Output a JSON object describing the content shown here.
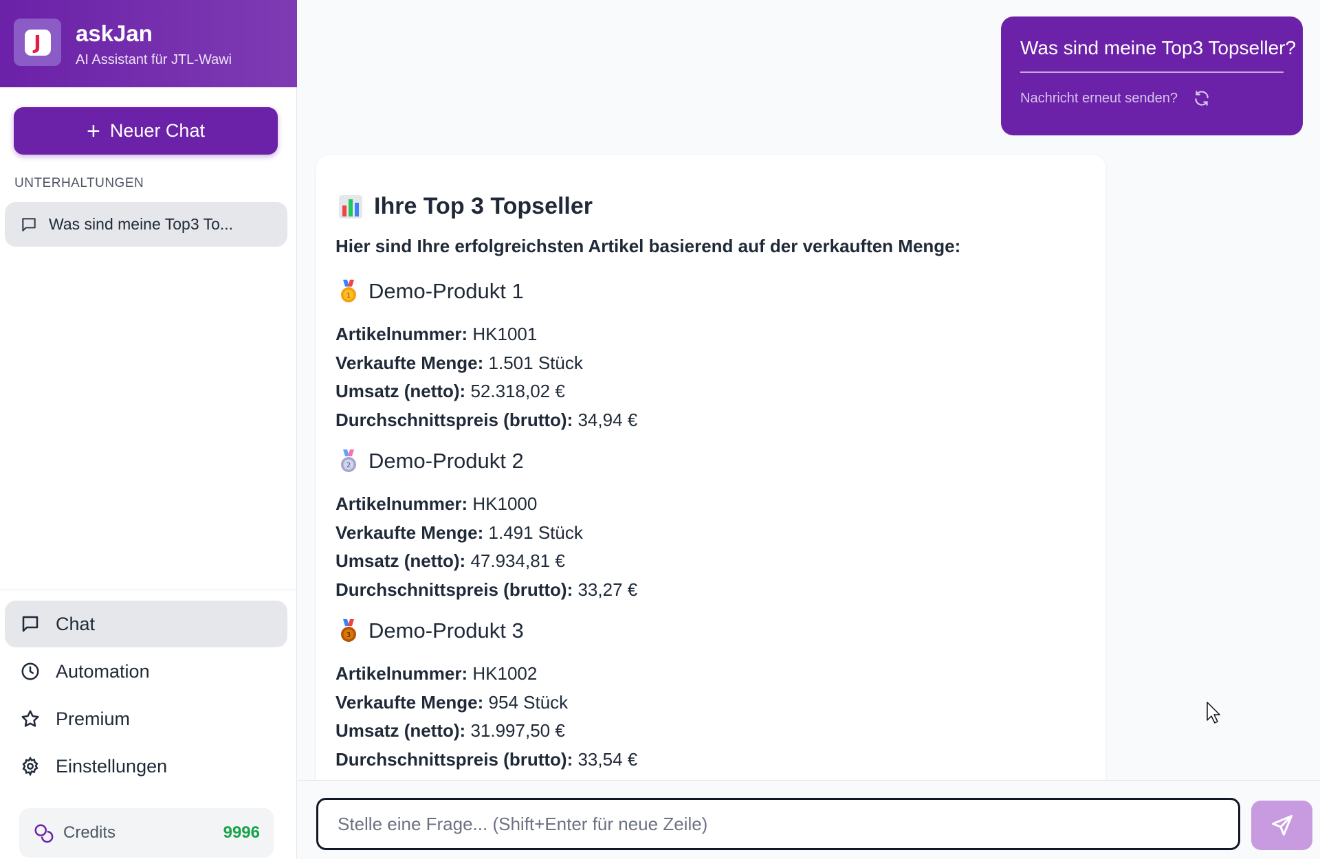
{
  "brand": {
    "title": "askJan",
    "subtitle": "AI Assistant für JTL-Wawi",
    "logo_letter": "J"
  },
  "sidebar": {
    "new_chat_label": "Neuer Chat",
    "conversations_heading": "UNTERHALTUNGEN",
    "conversations": [
      {
        "title": "Was sind meine Top3 To..."
      }
    ],
    "nav": [
      {
        "label": "Chat",
        "icon": "chat-icon",
        "active": true
      },
      {
        "label": "Automation",
        "icon": "clock-icon",
        "active": false
      },
      {
        "label": "Premium",
        "icon": "star-icon",
        "active": false
      },
      {
        "label": "Einstellungen",
        "icon": "gear-icon",
        "active": false
      }
    ],
    "credits": {
      "label": "Credits",
      "value": "9996"
    }
  },
  "user_message": {
    "text": "Was sind meine Top3 Topseller?",
    "resend_label": "Nachricht erneut senden?"
  },
  "answer": {
    "title": "Ihre Top 3 Topseller",
    "intro": "Hier sind Ihre erfolgreichsten Artikel basierend auf der verkauften Menge:",
    "products": [
      {
        "name": "Demo-Produkt 1",
        "medal": "gold",
        "rows": [
          {
            "key": "Artikelnummer:",
            "value": "HK1001"
          },
          {
            "key": "Verkaufte Menge:",
            "value": "1.501 Stück"
          },
          {
            "key": "Umsatz (netto):",
            "value": "52.318,02 €"
          },
          {
            "key": "Durchschnittspreis (brutto):",
            "value": "34,94 €"
          }
        ]
      },
      {
        "name": "Demo-Produkt 2",
        "medal": "silver",
        "rows": [
          {
            "key": "Artikelnummer:",
            "value": "HK1000"
          },
          {
            "key": "Verkaufte Menge:",
            "value": "1.491 Stück"
          },
          {
            "key": "Umsatz (netto):",
            "value": "47.934,81 €"
          },
          {
            "key": "Durchschnittspreis (brutto):",
            "value": "33,27 €"
          }
        ]
      },
      {
        "name": "Demo-Produkt 3",
        "medal": "bronze",
        "rows": [
          {
            "key": "Artikelnummer:",
            "value": "HK1002"
          },
          {
            "key": "Verkaufte Menge:",
            "value": "954 Stück"
          },
          {
            "key": "Umsatz (netto):",
            "value": "31.997,50 €"
          },
          {
            "key": "Durchschnittspreis (brutto):",
            "value": "33,54 €"
          }
        ]
      }
    ]
  },
  "composer": {
    "placeholder": "Stelle eine Frage... (Shift+Enter für neue Zeile)"
  },
  "colors": {
    "brand": "#6b21a8",
    "send_button": "#c89ae0",
    "credits_value": "#16a34a",
    "active_nav": "#e5e7eb"
  }
}
